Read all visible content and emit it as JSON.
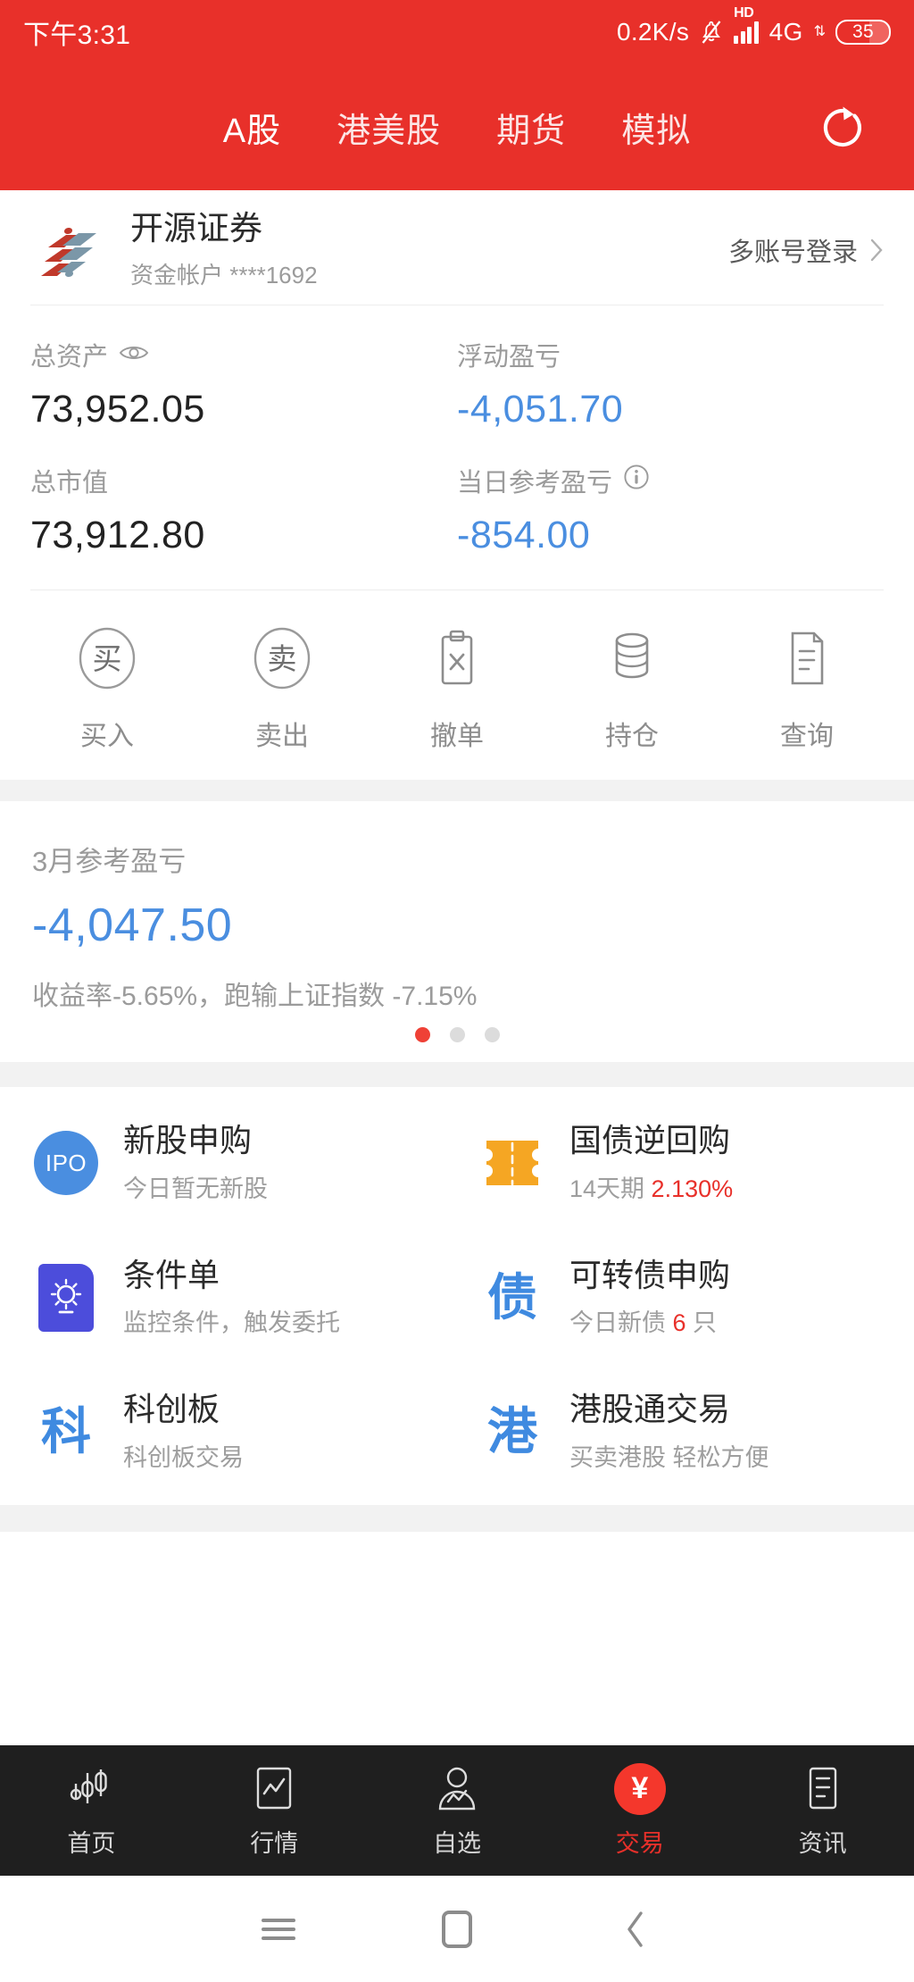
{
  "status_bar": {
    "time": "下午3:31",
    "net_speed": "0.2K/s",
    "mute_icon": "bell-off-icon",
    "hd_label": "HD",
    "network": "4G",
    "data_arrows": "⇅",
    "battery": "35"
  },
  "header": {
    "tabs": [
      {
        "label": "A股",
        "active": true
      },
      {
        "label": "港美股",
        "active": false
      },
      {
        "label": "期货",
        "active": false
      },
      {
        "label": "模拟",
        "active": false
      }
    ],
    "refresh_icon": "refresh-icon",
    "background_color": "#e8302a"
  },
  "broker": {
    "logo_icon": "broker-logo-icon",
    "name": "开源证券",
    "account": "资金帐户 ****1692",
    "multi_login_label": "多账号登录",
    "chevron_icon": "chevron-right-icon"
  },
  "assets": {
    "total_assets": {
      "label": "总资产",
      "icon": "eye-icon",
      "value": "73,952.05",
      "color": "#222222"
    },
    "floating_pnl": {
      "label": "浮动盈亏",
      "value": "-4,051.70",
      "color": "#4a8ee0"
    },
    "market_value": {
      "label": "总市值",
      "value": "73,912.80",
      "color": "#222222"
    },
    "daily_pnl": {
      "label": "当日参考盈亏",
      "icon": "info-icon",
      "value": "-854.00",
      "color": "#4a8ee0"
    }
  },
  "actions": [
    {
      "label": "买入",
      "icon": "buy-circle-icon",
      "glyph": "买"
    },
    {
      "label": "卖出",
      "icon": "sell-circle-icon",
      "glyph": "卖"
    },
    {
      "label": "撤单",
      "icon": "cancel-order-clipboard-icon"
    },
    {
      "label": "持仓",
      "icon": "position-stack-icon"
    },
    {
      "label": "查询",
      "icon": "query-document-icon"
    }
  ],
  "month_card": {
    "title": "3月参考盈亏",
    "value": "-4,047.50",
    "value_color": "#4a8ee0",
    "subtitle": "收益率-5.65%，跑输上证指数 -7.15%",
    "dots_total": 3,
    "dot_active_index": 0,
    "dot_active_color": "#ef4136"
  },
  "features": [
    {
      "title": "新股申购",
      "subtitle": "今日暂无新股",
      "subtitle_highlight": "",
      "subtitle_suffix": "",
      "icon": "ipo-badge-icon",
      "icon_text": "IPO",
      "icon_color": "#4a8ee0"
    },
    {
      "title": "国债逆回购",
      "subtitle": "14天期 ",
      "subtitle_highlight": "2.130%",
      "subtitle_suffix": "",
      "icon": "treasury-repo-ticket-icon",
      "icon_text": "",
      "icon_color": "#f5a623"
    },
    {
      "title": "条件单",
      "subtitle": "监控条件，触发委托",
      "subtitle_highlight": "",
      "subtitle_suffix": "",
      "icon": "conditional-order-bulb-icon",
      "icon_text": "",
      "icon_color": "#4c4ddb"
    },
    {
      "title": "可转债申购",
      "subtitle": "今日新债 ",
      "subtitle_highlight": "6",
      "subtitle_suffix": " 只",
      "icon": "convertible-bond-icon",
      "icon_text": "债",
      "icon_color": "#3f8ae0"
    },
    {
      "title": "科创板",
      "subtitle": "科创板交易",
      "subtitle_highlight": "",
      "subtitle_suffix": "",
      "icon": "star-market-icon",
      "icon_text": "科",
      "icon_color": "#3f8ae0"
    },
    {
      "title": "港股通交易",
      "subtitle": "买卖港股 轻松方便",
      "subtitle_highlight": "",
      "subtitle_suffix": "",
      "icon": "hk-connect-icon",
      "icon_text": "港",
      "icon_color": "#3f8ae0"
    }
  ],
  "bottom_nav": [
    {
      "label": "首页",
      "icon": "candlestick-icon",
      "active": false
    },
    {
      "label": "行情",
      "icon": "market-chart-icon",
      "active": false
    },
    {
      "label": "自选",
      "icon": "watchlist-person-icon",
      "active": false
    },
    {
      "label": "交易",
      "icon": "trade-yen-icon",
      "glyph": "¥",
      "active": true
    },
    {
      "label": "资讯",
      "icon": "news-document-icon",
      "active": false
    }
  ],
  "system_bar": {
    "recents_icon": "menu-icon",
    "home_icon": "home-square-icon",
    "back_icon": "back-chevron-icon"
  }
}
